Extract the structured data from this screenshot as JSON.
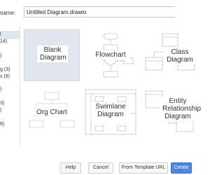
{
  "header": {
    "filename_label": "name:",
    "filename_value": "Untitled Diagram.drawio"
  },
  "sidebar": {
    "items": [
      {
        "label": "l"
      },
      {
        "label": "14)"
      },
      {
        "label": ")"
      },
      {
        "label": "g (3)"
      },
      {
        "label": "s (9)"
      },
      {
        "label": ")"
      },
      {
        "label": "3)"
      },
      {
        "label": ")"
      },
      {
        "label": "8)"
      }
    ]
  },
  "templates": [
    {
      "label": "Blank\nDiagram",
      "selected": true
    },
    {
      "label": "Flowchart"
    },
    {
      "label": "Class\nDiagram"
    },
    {
      "label": "Org Chart"
    },
    {
      "label": "Swimlane\nDiagram"
    },
    {
      "label": "Entity\nRelationship\nDiagram"
    }
  ],
  "footer": {
    "help_label": "Help",
    "cancel_label": "Cancel",
    "template_url_label": "From Template URL",
    "create_label": "Create"
  },
  "colors": {
    "selection": "#e1e6ee",
    "primary": "#4a86e8"
  }
}
